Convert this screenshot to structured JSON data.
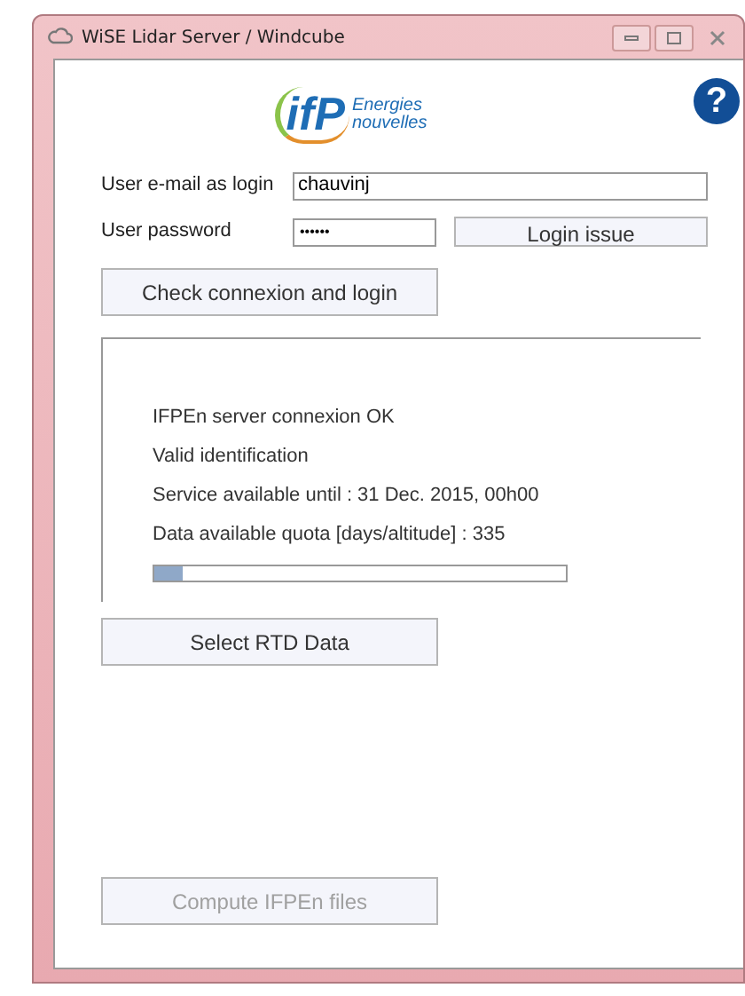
{
  "window": {
    "title": "WiSE Lidar Server / Windcube"
  },
  "logo": {
    "mark": "ifP",
    "line_1": "Energies",
    "line_2": "nouvelles"
  },
  "help": {
    "glyph": "?"
  },
  "login": {
    "email_label": "User e-mail as login",
    "email_value": "chauvinj",
    "password_label": "User password",
    "password_value": "••••••"
  },
  "buttons": [
    {
      "label": "Login issue",
      "disabled": false
    },
    {
      "label": "Check connexion and login",
      "disabled": false
    },
    {
      "label": "Select RTD Data",
      "disabled": false
    },
    {
      "label": "Compute IFPEn files",
      "disabled": true
    }
  ],
  "status": {
    "lines": [
      "IFPEn server connexion OK",
      "Valid identification",
      "Service available until : 31 Dec. 2015, 00h00",
      "Data available quota [days/altitude] : 335"
    ],
    "progress": {
      "level": 0.07
    }
  }
}
